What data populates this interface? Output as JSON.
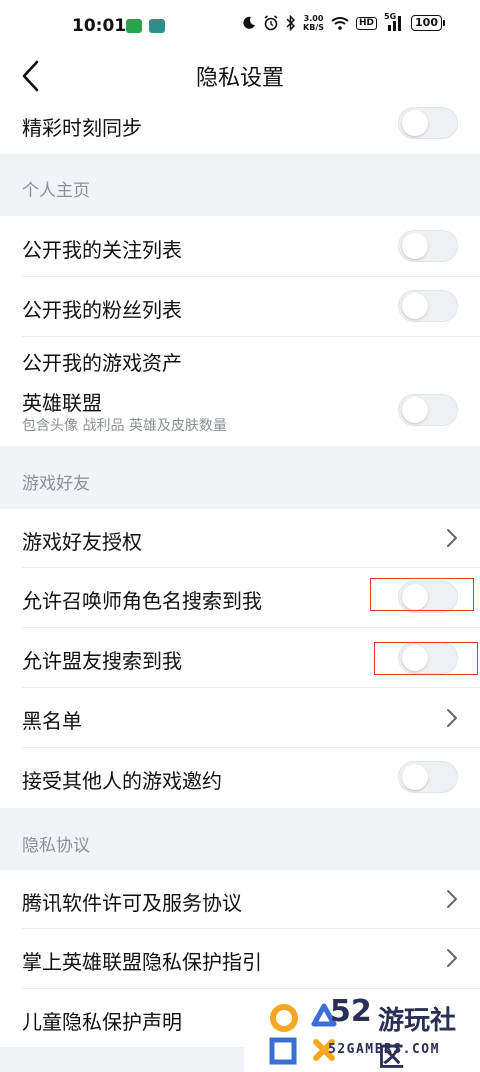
{
  "status_bar": {
    "time": "10:01",
    "speed_value": "3.00",
    "speed_unit": "KB/S",
    "hd": "HD",
    "network": "5G",
    "battery": "100"
  },
  "header": {
    "title": "隐私设置"
  },
  "settings": {
    "highlight_sync": "精彩时刻同步",
    "section_profile": "个人主页",
    "public_follow": "公开我的关注列表",
    "public_fans": "公开我的粉丝列表",
    "public_assets": "公开我的游戏资产",
    "game_lol": "英雄联盟",
    "game_lol_desc": "包含头像 战利品 英雄及皮肤数量",
    "section_friends": "游戏好友",
    "friend_auth": "游戏好友授权",
    "search_by_summoner": "允许召唤师角色名搜索到我",
    "search_by_ally": "允许盟友搜索到我",
    "blacklist": "黑名单",
    "accept_invites": "接受其他人的游戏邀约",
    "section_privacy": "隐私协议",
    "tencent_license": "腾讯软件许可及服务协议",
    "privacy_guide": "掌上英雄联盟隐私保护指引",
    "child_privacy": "儿童隐私保护声明"
  },
  "toggles": {
    "highlight_sync": false,
    "public_follow": false,
    "public_fans": false,
    "game_lol": false,
    "search_by_summoner": false,
    "search_by_ally": false,
    "accept_invites": false
  },
  "watermark": {
    "number": "52",
    "name": "游玩社区",
    "domain": "52GAMERS.COM"
  },
  "colors": {
    "background": "#f1f3f6",
    "highlight_border": "#e43a3a",
    "watermark_orange": "#f5a623",
    "watermark_blue": "#3a6fd8",
    "watermark_text": "#2a2f55"
  },
  "icons": [
    "back-arrow-icon",
    "chevron-right-icon",
    "moon-icon",
    "alarm-icon",
    "bluetooth-icon",
    "wifi-icon",
    "signal-icon",
    "battery-icon"
  ]
}
